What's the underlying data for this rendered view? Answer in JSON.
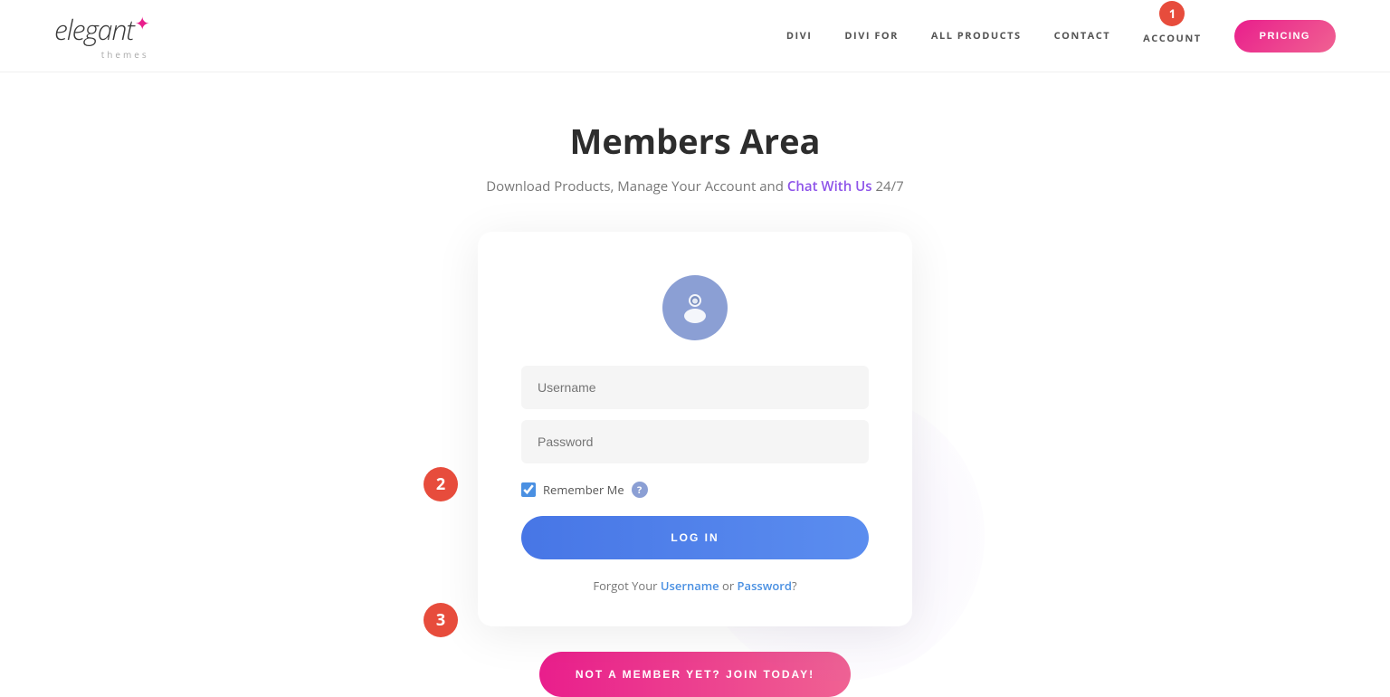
{
  "header": {
    "logo": {
      "name": "elegant",
      "star": "✦",
      "sub": "themes"
    },
    "nav": {
      "items": [
        {
          "label": "DIVI",
          "id": "divi"
        },
        {
          "label": "DIVI FOR",
          "id": "divi-for"
        },
        {
          "label": "ALL PRODUCTS",
          "id": "all-products"
        },
        {
          "label": "CONTACT",
          "id": "contact"
        },
        {
          "label": "ACCOUNT",
          "id": "account"
        }
      ],
      "account_badge": "1",
      "pricing_label": "PRICING"
    }
  },
  "main": {
    "title": "Members Area",
    "subtitle_before": "Download Products, Manage Your Account and ",
    "subtitle_link": "Chat With Us",
    "subtitle_after": " 24/7",
    "login_card": {
      "username_placeholder": "Username",
      "password_placeholder": "Password",
      "remember_label": "Remember Me",
      "login_button": "LOG IN",
      "forgot_before": "Forgot Your ",
      "forgot_username": "Username",
      "forgot_or": " or ",
      "forgot_password": "Password",
      "forgot_after": "?"
    },
    "join_button": "NOT A MEMBER YET? JOIN TODAY!"
  },
  "annotations": {
    "badge1": "1",
    "badge2": "2",
    "badge3": "3"
  },
  "colors": {
    "pink": "#e91e8c",
    "blue": "#4776e6",
    "red": "#e74c3c",
    "purple": "#8e54e9",
    "avatar_bg": "#8b9fd4"
  }
}
